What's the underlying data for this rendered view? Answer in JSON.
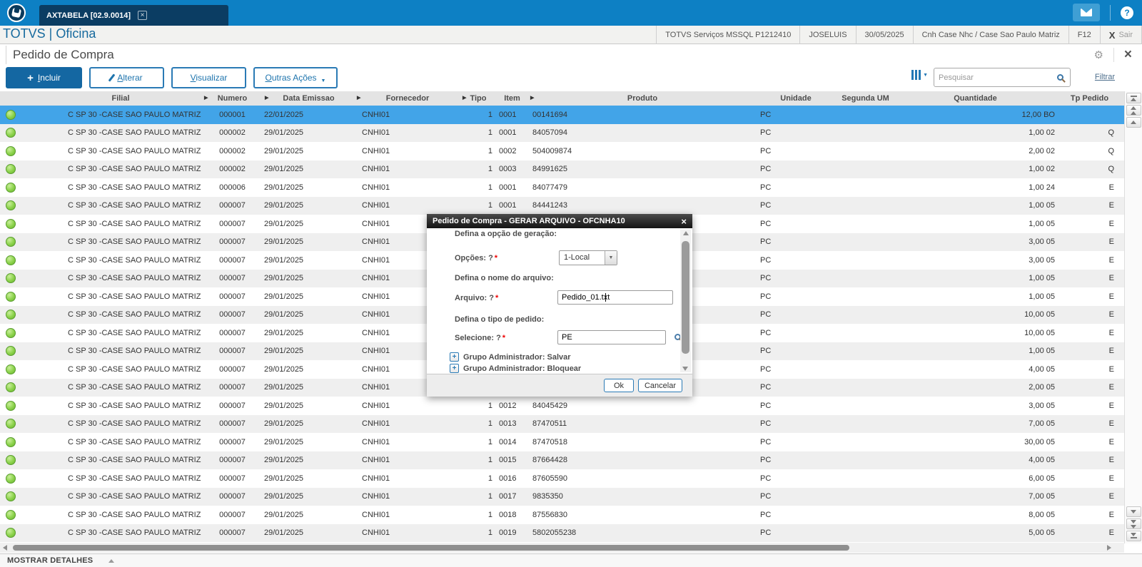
{
  "topbar": {
    "tab_title": "AXTABELA [02.9.0014]",
    "tab_close": "×"
  },
  "subheader": {
    "brand": "TOTVS | Oficina",
    "environment": "TOTVS Serviços MSSQL P1212410",
    "user": "JOSELUIS",
    "date": "30/05/2025",
    "company": "Cnh Case Nhc / Case Sao Paulo Matriz",
    "fkey": "F12",
    "exit_x": "X",
    "exit_label": "Sair"
  },
  "page": {
    "title": "Pedido de Compra",
    "close": "×"
  },
  "toolbar": {
    "incluir": "Incluir",
    "alterar": "Alterar",
    "visualizar": "Visualizar",
    "outras_acoes": "Outras Ações",
    "search_placeholder": "Pesquisar",
    "filtrar": "Filtrar"
  },
  "table": {
    "columns": [
      "",
      "Filial",
      "Numero",
      "Data Emissao",
      "Fornecedor",
      "Tipo",
      "Item",
      "Produto",
      "Unidade",
      "Segunda UM",
      "Quantidade",
      "Tp Pedido"
    ],
    "rows": [
      {
        "filial": "C SP 30 -CASE SAO PAULO MATRIZ",
        "numero": "000001",
        "data": "22/01/2025",
        "forn": "CNHI01",
        "tipo": "1",
        "item": "0001",
        "produto": "00141694",
        "un": "PC",
        "qtd": "12,00",
        "qtd_um": "BO",
        "tp": "",
        "selected": true
      },
      {
        "filial": "C SP 30 -CASE SAO PAULO MATRIZ",
        "numero": "000002",
        "data": "29/01/2025",
        "forn": "CNHI01",
        "tipo": "1",
        "item": "0001",
        "produto": "84057094",
        "un": "PC",
        "qtd": "1,00",
        "qtd_um": "02",
        "tp": "Q",
        "selected": false
      },
      {
        "filial": "C SP 30 -CASE SAO PAULO MATRIZ",
        "numero": "000002",
        "data": "29/01/2025",
        "forn": "CNHI01",
        "tipo": "1",
        "item": "0002",
        "produto": "504009874",
        "un": "PC",
        "qtd": "2,00",
        "qtd_um": "02",
        "tp": "Q",
        "selected": false
      },
      {
        "filial": "C SP 30 -CASE SAO PAULO MATRIZ",
        "numero": "000002",
        "data": "29/01/2025",
        "forn": "CNHI01",
        "tipo": "1",
        "item": "0003",
        "produto": "84991625",
        "un": "PC",
        "qtd": "1,00",
        "qtd_um": "02",
        "tp": "Q",
        "selected": false
      },
      {
        "filial": "C SP 30 -CASE SAO PAULO MATRIZ",
        "numero": "000006",
        "data": "29/01/2025",
        "forn": "CNHI01",
        "tipo": "1",
        "item": "0001",
        "produto": "84077479",
        "un": "PC",
        "qtd": "1,00",
        "qtd_um": "24",
        "tp": "E",
        "selected": false
      },
      {
        "filial": "C SP 30 -CASE SAO PAULO MATRIZ",
        "numero": "000007",
        "data": "29/01/2025",
        "forn": "CNHI01",
        "tipo": "1",
        "item": "0001",
        "produto": "84441243",
        "un": "PC",
        "qtd": "1,00",
        "qtd_um": "05",
        "tp": "E",
        "selected": false
      },
      {
        "filial": "C SP 30 -CASE SAO PAULO MATRIZ",
        "numero": "000007",
        "data": "29/01/2025",
        "forn": "CNHI01",
        "tipo": "",
        "item": "",
        "produto": "",
        "un": "PC",
        "qtd": "1,00",
        "qtd_um": "05",
        "tp": "E",
        "selected": false
      },
      {
        "filial": "C SP 30 -CASE SAO PAULO MATRIZ",
        "numero": "000007",
        "data": "29/01/2025",
        "forn": "CNHI01",
        "tipo": "",
        "item": "",
        "produto": "",
        "un": "PC",
        "qtd": "3,00",
        "qtd_um": "05",
        "tp": "E",
        "selected": false
      },
      {
        "filial": "C SP 30 -CASE SAO PAULO MATRIZ",
        "numero": "000007",
        "data": "29/01/2025",
        "forn": "CNHI01",
        "tipo": "",
        "item": "",
        "produto": "",
        "un": "PC",
        "qtd": "3,00",
        "qtd_um": "05",
        "tp": "E",
        "selected": false
      },
      {
        "filial": "C SP 30 -CASE SAO PAULO MATRIZ",
        "numero": "000007",
        "data": "29/01/2025",
        "forn": "CNHI01",
        "tipo": "",
        "item": "",
        "produto": "",
        "un": "PC",
        "qtd": "1,00",
        "qtd_um": "05",
        "tp": "E",
        "selected": false
      },
      {
        "filial": "C SP 30 -CASE SAO PAULO MATRIZ",
        "numero": "000007",
        "data": "29/01/2025",
        "forn": "CNHI01",
        "tipo": "",
        "item": "",
        "produto": "",
        "un": "PC",
        "qtd": "1,00",
        "qtd_um": "05",
        "tp": "E",
        "selected": false
      },
      {
        "filial": "C SP 30 -CASE SAO PAULO MATRIZ",
        "numero": "000007",
        "data": "29/01/2025",
        "forn": "CNHI01",
        "tipo": "",
        "item": "",
        "produto": "",
        "un": "PC",
        "qtd": "10,00",
        "qtd_um": "05",
        "tp": "E",
        "selected": false
      },
      {
        "filial": "C SP 30 -CASE SAO PAULO MATRIZ",
        "numero": "000007",
        "data": "29/01/2025",
        "forn": "CNHI01",
        "tipo": "",
        "item": "",
        "produto": "",
        "un": "PC",
        "qtd": "10,00",
        "qtd_um": "05",
        "tp": "E",
        "selected": false
      },
      {
        "filial": "C SP 30 -CASE SAO PAULO MATRIZ",
        "numero": "000007",
        "data": "29/01/2025",
        "forn": "CNHI01",
        "tipo": "",
        "item": "",
        "produto": "",
        "un": "PC",
        "qtd": "1,00",
        "qtd_um": "05",
        "tp": "E",
        "selected": false
      },
      {
        "filial": "C SP 30 -CASE SAO PAULO MATRIZ",
        "numero": "000007",
        "data": "29/01/2025",
        "forn": "CNHI01",
        "tipo": "",
        "item": "",
        "produto": "",
        "un": "PC",
        "qtd": "4,00",
        "qtd_um": "05",
        "tp": "E",
        "selected": false
      },
      {
        "filial": "C SP 30 -CASE SAO PAULO MATRIZ",
        "numero": "000007",
        "data": "29/01/2025",
        "forn": "CNHI01",
        "tipo": "",
        "item": "",
        "produto": "",
        "un": "PC",
        "qtd": "2,00",
        "qtd_um": "05",
        "tp": "E",
        "selected": false
      },
      {
        "filial": "C SP 30 -CASE SAO PAULO MATRIZ",
        "numero": "000007",
        "data": "29/01/2025",
        "forn": "CNHI01",
        "tipo": "1",
        "item": "0012",
        "produto": "84045429",
        "un": "PC",
        "qtd": "3,00",
        "qtd_um": "05",
        "tp": "E",
        "selected": false
      },
      {
        "filial": "C SP 30 -CASE SAO PAULO MATRIZ",
        "numero": "000007",
        "data": "29/01/2025",
        "forn": "CNHI01",
        "tipo": "1",
        "item": "0013",
        "produto": "87470511",
        "un": "PC",
        "qtd": "7,00",
        "qtd_um": "05",
        "tp": "E",
        "selected": false
      },
      {
        "filial": "C SP 30 -CASE SAO PAULO MATRIZ",
        "numero": "000007",
        "data": "29/01/2025",
        "forn": "CNHI01",
        "tipo": "1",
        "item": "0014",
        "produto": "87470518",
        "un": "PC",
        "qtd": "30,00",
        "qtd_um": "05",
        "tp": "E",
        "selected": false
      },
      {
        "filial": "C SP 30 -CASE SAO PAULO MATRIZ",
        "numero": "000007",
        "data": "29/01/2025",
        "forn": "CNHI01",
        "tipo": "1",
        "item": "0015",
        "produto": "87664428",
        "un": "PC",
        "qtd": "4,00",
        "qtd_um": "05",
        "tp": "E",
        "selected": false
      },
      {
        "filial": "C SP 30 -CASE SAO PAULO MATRIZ",
        "numero": "000007",
        "data": "29/01/2025",
        "forn": "CNHI01",
        "tipo": "1",
        "item": "0016",
        "produto": "87605590",
        "un": "PC",
        "qtd": "6,00",
        "qtd_um": "05",
        "tp": "E",
        "selected": false
      },
      {
        "filial": "C SP 30 -CASE SAO PAULO MATRIZ",
        "numero": "000007",
        "data": "29/01/2025",
        "forn": "CNHI01",
        "tipo": "1",
        "item": "0017",
        "produto": "9835350",
        "un": "PC",
        "qtd": "7,00",
        "qtd_um": "05",
        "tp": "E",
        "selected": false
      },
      {
        "filial": "C SP 30 -CASE SAO PAULO MATRIZ",
        "numero": "000007",
        "data": "29/01/2025",
        "forn": "CNHI01",
        "tipo": "1",
        "item": "0018",
        "produto": "87556830",
        "un": "PC",
        "qtd": "8,00",
        "qtd_um": "05",
        "tp": "E",
        "selected": false
      },
      {
        "filial": "C SP 30 -CASE SAO PAULO MATRIZ",
        "numero": "000007",
        "data": "29/01/2025",
        "forn": "CNHI01",
        "tipo": "1",
        "item": "0019",
        "produto": "5802055238",
        "un": "PC",
        "qtd": "5,00",
        "qtd_um": "05",
        "tp": "E",
        "selected": false
      }
    ]
  },
  "modal": {
    "title": "Pedido de Compra - GERAR ARQUIVO - OFCNHA10",
    "close": "×",
    "required_marker": "*",
    "section_geracao": "Defina a opção de geração:",
    "opcoes_label": "Opções: ?",
    "opcoes_value": "1-Local",
    "section_arquivo": "Defina o nome do arquivo:",
    "arquivo_label": "Arquivo: ?",
    "arquivo_value": "Pedido_01.txt",
    "section_pedido": "Defina o tipo de pedido:",
    "selecione_label": "Selecione: ?",
    "selecione_value": "PE",
    "tree_items": [
      "Grupo Administrador: Salvar",
      "Grupo Administrador: Bloquear"
    ],
    "ok": "Ok",
    "cancelar": "Cancelar"
  },
  "footer": {
    "label": "MOSTRAR DETALHES"
  },
  "colors": {
    "topbar_blue": "#0d80c4",
    "tab_navy": "#0b3d63",
    "accent_blue": "#1e74ad",
    "selected_row": "#42a4e8",
    "status_green": "#8bd24a",
    "header_gray": "#e4e4e4",
    "stripe_gray": "#efefef"
  }
}
